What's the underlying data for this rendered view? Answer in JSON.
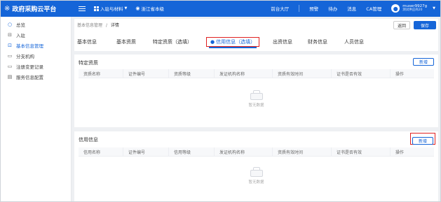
{
  "topbar": {
    "logo_mark": "※",
    "app_title": "政府采购云平台",
    "nav": [
      {
        "label": "入驻与材料"
      },
      {
        "label": "浙江省本级"
      }
    ],
    "links": [
      "前台大厅",
      "预警",
      "待办",
      "消息",
      "CA管理"
    ],
    "user": {
      "name": "muser9927g",
      "sub": "测试供应商20"
    }
  },
  "sidebar": {
    "items": [
      {
        "label": "总览",
        "icon": "circle-icon"
      },
      {
        "label": "入驻",
        "icon": "sign-icon"
      },
      {
        "label": "基本信息管理",
        "icon": "info-icon"
      },
      {
        "label": "分支机构",
        "icon": "branch-icon"
      },
      {
        "label": "注册变更记录",
        "icon": "record-icon"
      },
      {
        "label": "服务信息配置",
        "icon": "config-icon"
      }
    ]
  },
  "header": {
    "breadcrumb_parent": "基本信息管理",
    "breadcrumb_sep": "/",
    "breadcrumb_current": "详情",
    "back_label": "返回",
    "save_label": "保存"
  },
  "tabs": [
    "基本信息",
    "基本资质",
    "特定资质（选填）",
    "信用信息（选填）",
    "出资信息",
    "财务信息",
    "人员信息"
  ],
  "sections": [
    {
      "title": "特定资质",
      "add_label": "新增",
      "columns": [
        "资质名称",
        "证件编号",
        "资质等级",
        "发证机构名称",
        "资质有效时间",
        "证书是否有效",
        "操作"
      ],
      "empty_text": "暂无数据"
    },
    {
      "title": "信用信息",
      "add_label": "新增",
      "columns": [
        "信用名称",
        "证件编号",
        "信用等级",
        "发证机构名称",
        "资质有效时间",
        "证书是否有效",
        "操作"
      ],
      "empty_text": "暂无数据"
    }
  ],
  "colors": {
    "primary": "#1565d8",
    "highlight": "#e02020"
  }
}
